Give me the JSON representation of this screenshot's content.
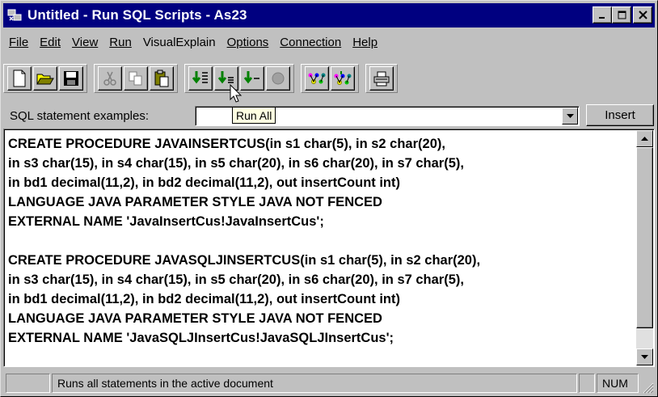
{
  "window": {
    "title": "Untitled - Run SQL Scripts - As23",
    "colors": {
      "titlebar": "#000080",
      "face": "#c0c0c0"
    }
  },
  "menu": {
    "items": [
      {
        "label": "File"
      },
      {
        "label": "Edit"
      },
      {
        "label": "View"
      },
      {
        "label": "Run"
      },
      {
        "label": "VisualExplain"
      },
      {
        "label": "Options"
      },
      {
        "label": "Connection"
      },
      {
        "label": "Help"
      }
    ]
  },
  "toolbar": {
    "icons": [
      "new-document-icon",
      "open-folder-icon",
      "save-icon",
      "cut-icon",
      "copy-icon",
      "paste-icon",
      "run-all-icon",
      "run-from-selected-icon",
      "run-selected-icon",
      "stop-icon",
      "visual-explain-icon",
      "run-and-explain-icon",
      "print-icon"
    ]
  },
  "examples": {
    "label": "SQL statement examples:",
    "value": "",
    "insert_label": "Insert"
  },
  "tooltip": {
    "text": "Run All"
  },
  "editor": {
    "lines": [
      "CREATE PROCEDURE JAVAINSERTCUS(in s1 char(5), in s2 char(20),",
      "in s3 char(15), in s4 char(15), in s5 char(20), in s6 char(20), in s7 char(5),",
      "in bd1 decimal(11,2), in bd2 decimal(11,2), out insertCount int)",
      "LANGUAGE JAVA PARAMETER STYLE JAVA NOT FENCED",
      "EXTERNAL NAME 'JavaInsertCus!JavaInsertCus';",
      "",
      "CREATE PROCEDURE JAVASQLJINSERTCUS(in s1 char(5), in s2 char(20),",
      "in s3 char(15), in s4 char(15), in s5 char(20), in s6 char(20), in s7 char(5),",
      "in bd1 decimal(11,2), in bd2 decimal(11,2), out insertCount int)",
      "LANGUAGE JAVA PARAMETER STYLE JAVA NOT FENCED",
      "EXTERNAL NAME 'JavaSQLJInsertCus!JavaSQLJInsertCus';"
    ]
  },
  "status": {
    "message": "Runs all statements in the active document",
    "indicator": "NUM"
  }
}
